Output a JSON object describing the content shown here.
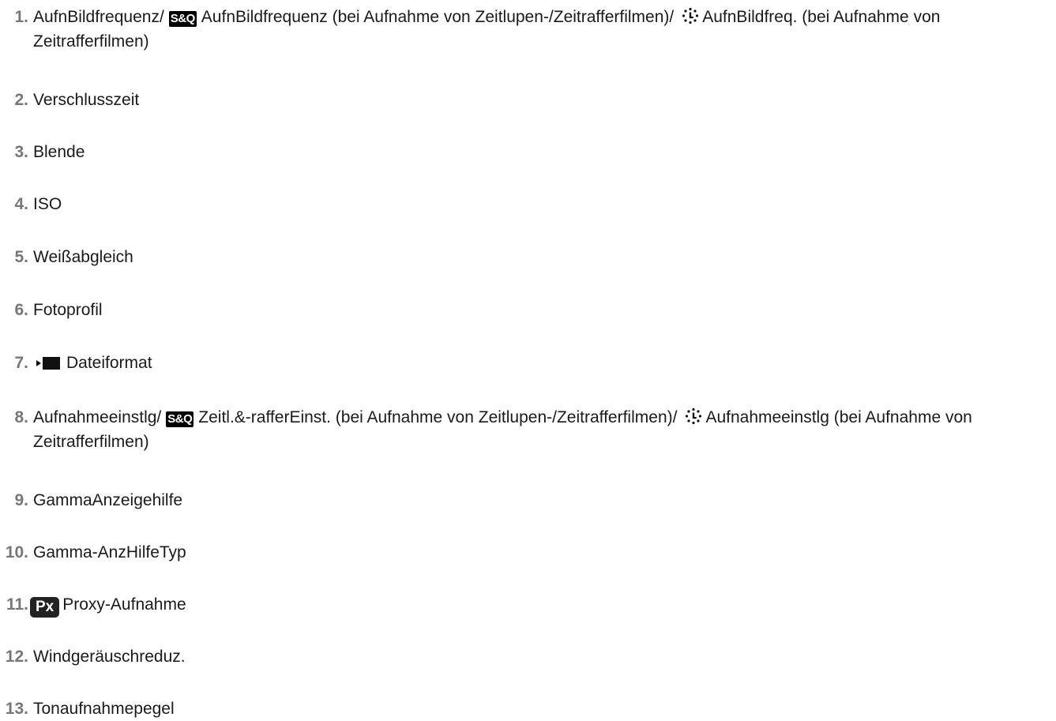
{
  "icons": {
    "sq": "S&Q",
    "px": "Px",
    "timelapse": "timelapse-icon",
    "movie": "movie-icon"
  },
  "items": [
    {
      "num": "1.",
      "a": "AufnBildfrequenz/",
      "b": "AufnBildfrequenz (bei Aufnahme von Zeitlupen-/Zeitrafferfilmen)/",
      "c": "AufnBildfreq. (bei Aufnahme von Zeitrafferfilmen)"
    },
    {
      "num": "2.",
      "text": "Verschlusszeit"
    },
    {
      "num": "3.",
      "text": "Blende"
    },
    {
      "num": "4.",
      "text": "ISO"
    },
    {
      "num": "5.",
      "text": "Weißabgleich"
    },
    {
      "num": "6.",
      "text": "Fotoprofil"
    },
    {
      "num": "7.",
      "text": "Dateiformat"
    },
    {
      "num": "8.",
      "a": "Aufnahmeeinstlg/",
      "b": "Zeitl.&-rafferEinst. (bei Aufnahme von Zeitlupen-/Zeitrafferfilmen)/",
      "c": "Aufnahmeeinstlg (bei Aufnahme von Zeitrafferfilmen)"
    },
    {
      "num": "9.",
      "text": "GammaAnzeigehilfe"
    },
    {
      "num": "10.",
      "text": "Gamma-AnzHilfeTyp"
    },
    {
      "num": "11.",
      "text": "Proxy-Aufnahme"
    },
    {
      "num": "12.",
      "text": "Windgeräuschreduz."
    },
    {
      "num": "13.",
      "text": "Tonaufnahmepegel"
    }
  ]
}
